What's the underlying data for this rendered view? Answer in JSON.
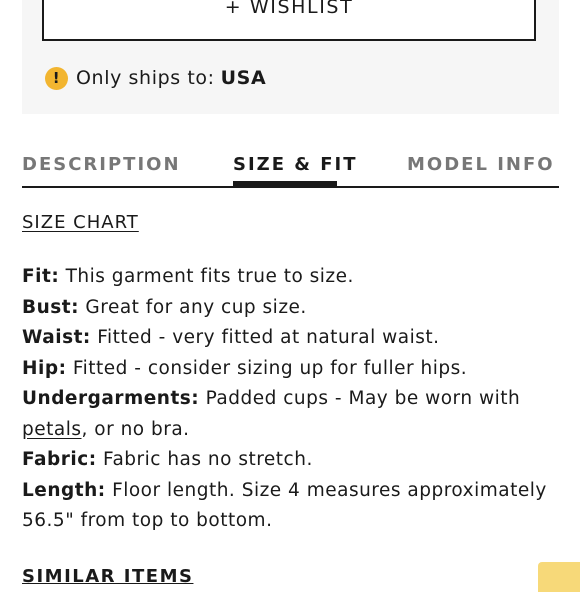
{
  "wishlist": {
    "label": "+ WISHLIST"
  },
  "shipping": {
    "icon": "warning-icon",
    "label": "Only ships to:",
    "value": "USA"
  },
  "tabs": [
    {
      "label": "DESCRIPTION",
      "active": false
    },
    {
      "label": "SIZE & FIT",
      "active": true
    },
    {
      "label": "MODEL INFO",
      "active": false
    }
  ],
  "size_chart_link": "SIZE CHART",
  "fit_details": {
    "fit": {
      "label": "Fit:",
      "text": "This garment fits true to size."
    },
    "bust": {
      "label": "Bust:",
      "text": "Great for any cup size."
    },
    "waist": {
      "label": "Waist:",
      "text": "Fitted - very fitted at natural waist."
    },
    "hip": {
      "label": "Hip:",
      "text": "Fitted - consider sizing up for fuller hips."
    },
    "undergarments": {
      "label": "Undergarments:",
      "text": "Padded cups - May be worn with",
      "link": "petals",
      "text_after": ", or no bra."
    },
    "fabric": {
      "label": "Fabric:",
      "text": "Fabric has no stretch."
    },
    "length": {
      "label": "Length:",
      "text": "Floor length. Size 4 measures approximately 56.5\" from top to bottom."
    }
  },
  "similar_items": {
    "label": "SIMILAR ITEMS"
  },
  "colors": {
    "accent_yellow": "#f2b530",
    "text": "#1a1a1a",
    "muted": "#777777",
    "panel_bg": "#f6f6f6"
  }
}
